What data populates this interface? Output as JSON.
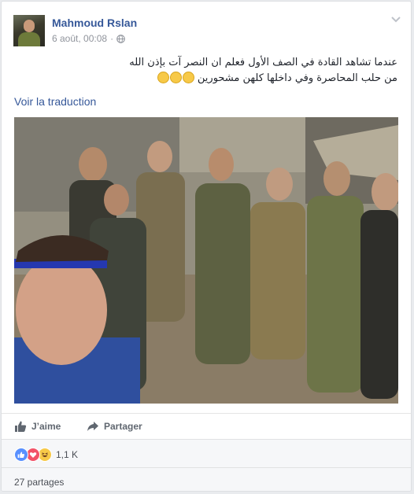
{
  "post": {
    "author": "Mahmoud Rslan",
    "timestamp": "6 août, 00:08",
    "separator": "·",
    "text_line1": "عندما تشاهد القادة في الصف الأول فعلم ان النصر آت بإذن الله",
    "text_line2": "من حلب المحاصرة وفي داخلها كلهن مشحورين",
    "emoji_icon": "laughing-emoji",
    "see_translation": "Voir la traduction"
  },
  "actions": {
    "like_label": "J’aime",
    "share_label": "Partager"
  },
  "reactions": {
    "types": [
      "like",
      "love",
      "haha"
    ],
    "count": "1,1 K"
  },
  "shares": {
    "label": "27 partages"
  },
  "colors": {
    "link": "#365899",
    "secondary": "#90949c",
    "like_blue": "#5890ff",
    "love_red": "#f25268",
    "haha_yellow": "#f7c948"
  }
}
